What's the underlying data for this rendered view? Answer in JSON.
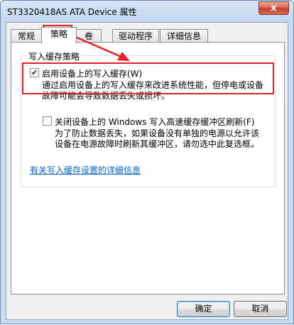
{
  "window": {
    "title": "ST3320418AS ATA Device 属性",
    "close_glyph": "x"
  },
  "tabs": [
    {
      "label": "常规"
    },
    {
      "label": "策略"
    },
    {
      "label": "卷"
    },
    {
      "label": "驱动程序"
    },
    {
      "label": "详细信息"
    }
  ],
  "active_tab": "策略",
  "write_cache": {
    "group_title": "写入缓存策略",
    "enable": {
      "label": "启用设备上的写入缓存(W)",
      "checked": true,
      "description_line1": "通过启用设备上的写入缓存来改进系统性能，但停电或设备",
      "description_line2": "故障可能会导致数据丢失或损坏。"
    },
    "flush": {
      "label": "关闭设备上的 Windows 写入高速缓存缓冲区刷新(F)",
      "checked": false,
      "description_line1": "为了防止数据丢失，如果设备没有单独的电源以允许该",
      "description_line2": "设备在电源故障时刷新其缓冲区，请勿选中此复选框。"
    },
    "details_link": "有关写入缓存设置的详细信息"
  },
  "buttons": {
    "ok": "确定",
    "cancel": "取消"
  },
  "annotation_color": "#e0202a"
}
